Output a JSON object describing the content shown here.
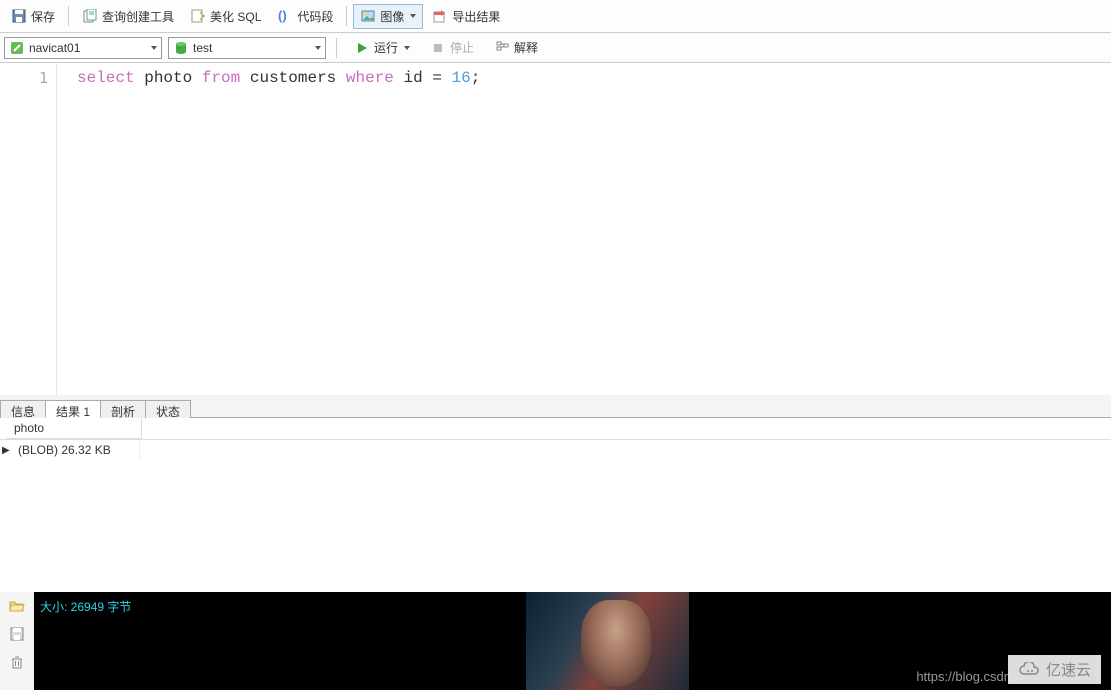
{
  "toolbar": {
    "save": "保存",
    "query_builder": "查询创建工具",
    "beautify": "美化 SQL",
    "snippet": "代码段",
    "image": "图像",
    "export": "导出结果"
  },
  "sub_toolbar": {
    "connection": "navicat01",
    "database": "test",
    "run": "运行",
    "stop": "停止",
    "explain": "解释"
  },
  "editor": {
    "line_no": "1",
    "tokens": {
      "select": "select",
      "photo": "photo",
      "from": "from",
      "customers": "customers",
      "where": "where",
      "id": "id",
      "eq": "=",
      "val": "16",
      "semi": ";"
    }
  },
  "tabs": {
    "info": "信息",
    "result": "结果 1",
    "profile": "剖析",
    "status": "状态"
  },
  "result": {
    "column": "photo",
    "value": "(BLOB) 26.32 KB"
  },
  "preview": {
    "size_label": "大小: 26949 字节",
    "watermark_link": "https://blog.csdn",
    "watermark_brand": "亿速云"
  }
}
